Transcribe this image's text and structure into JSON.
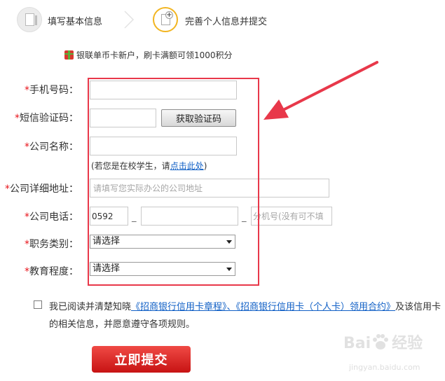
{
  "steps": [
    {
      "label": "填写基本信息"
    },
    {
      "label": "完善个人信息并提交"
    }
  ],
  "promo": {
    "text": "银联单币卡新户，刷卡满额可领1000积分"
  },
  "form": {
    "required_mark": "*",
    "mobile": {
      "label": "手机号码：",
      "value": ""
    },
    "sms_code": {
      "label": "短信验证码：",
      "value": "",
      "button": "获取验证码"
    },
    "company_name": {
      "label": "公司名称：",
      "value": ""
    },
    "student_hint": {
      "before": "(若您是在校学生，请",
      "link": "点击此处",
      "after": ")"
    },
    "company_address": {
      "label": "公司详细地址：",
      "placeholder": "请填写您实际办公的公司地址"
    },
    "company_phone": {
      "label": "公司电话：",
      "area_code": "0592",
      "dash": "_",
      "extension_placeholder": "分机号(没有可不填"
    },
    "job_type": {
      "label": "职务类别：",
      "selected": "请选择"
    },
    "education": {
      "label": "教育程度：",
      "selected": "请选择"
    }
  },
  "agreement": {
    "prefix": "我已阅读并清楚知晓",
    "link": "《招商银行信用卡章程》、《招商银行信用卡（个人卡）领用合约》",
    "suffix": "及该信用卡的相关信息，并愿意遵守各项规则。",
    "checked": false
  },
  "submit": {
    "label": "立即提交"
  },
  "watermark": {
    "brand": "Bai",
    "brand_suffix": "经验",
    "sub": "jingyan.baidu.com"
  },
  "colors": {
    "accent": "#e8384a",
    "submit": "#d81e1e",
    "link": "#1160c6",
    "step_active": "#f2b521"
  }
}
